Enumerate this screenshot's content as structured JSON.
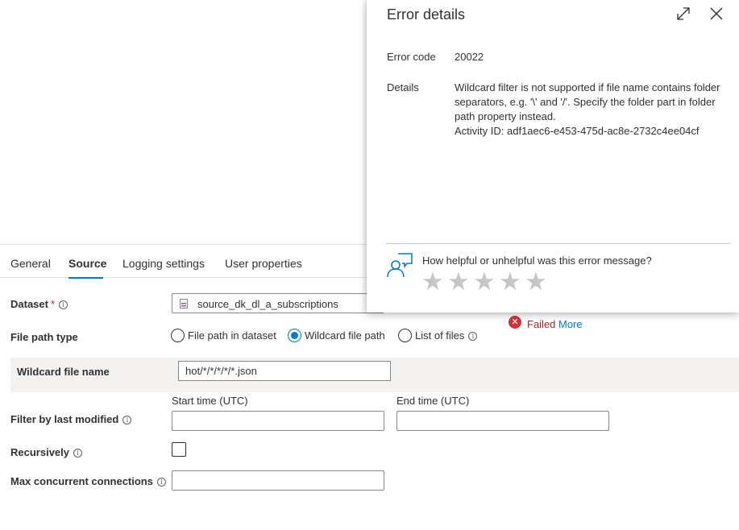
{
  "tabs": [
    {
      "label": "General"
    },
    {
      "label": "Source"
    },
    {
      "label": "Logging settings"
    },
    {
      "label": "User properties"
    }
  ],
  "form": {
    "dataset": {
      "label": "Dataset",
      "required_mark": "*",
      "value": "source_dk_dl_a_subscriptions"
    },
    "file_path_type": {
      "label": "File path type",
      "options": [
        {
          "label": "File path in dataset",
          "checked": false
        },
        {
          "label": "Wildcard file path",
          "checked": true
        },
        {
          "label": "List of files",
          "checked": false
        }
      ]
    },
    "wildcard_file_name": {
      "label": "Wildcard file name",
      "value": "hot/*/*/*/*/*.json"
    },
    "filter_by_last_modified": {
      "label": "Filter by last modified",
      "start_label": "Start time (UTC)",
      "end_label": "End time (UTC)",
      "start_value": "",
      "end_value": ""
    },
    "recursively": {
      "label": "Recursively",
      "checked": false
    },
    "max_concurrent_connections": {
      "label": "Max concurrent connections",
      "value": ""
    }
  },
  "status": {
    "text": "Failed",
    "link": "More",
    "color": "#d13438"
  },
  "error_panel": {
    "title": "Error details",
    "error_code_label": "Error code",
    "error_code": "20022",
    "details_label": "Details",
    "details_lines": [
      "Wildcard filter is not supported if file name contains folder",
      "separators, e.g. '\\' and '/'. Specify the folder part in folder",
      "path property instead.",
      "Activity ID: adf1aec6-e453-475d-ac8e-2732c4ee04cf"
    ],
    "feedback_question": "How helpful or unhelpful was this error message?",
    "rating_stars": 5,
    "rating_value": 0
  },
  "icons": {
    "expand": "expand-icon",
    "close": "close-icon",
    "feedback": "feedback-icon",
    "info": "info-icon",
    "failed": "error-x-icon",
    "dataset": "dataset-file-icon"
  },
  "colors": {
    "accent": "#0078d4",
    "error": "#d13438",
    "star": "#c8c6c4"
  }
}
